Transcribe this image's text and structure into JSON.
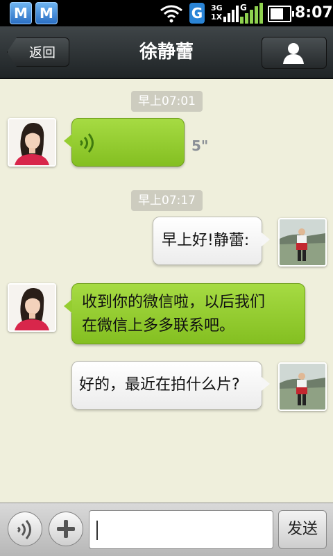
{
  "status_bar": {
    "app_icon_1": "M",
    "app_icon_2": "M",
    "g_badge": "G",
    "network_top": "3G",
    "network_bottom": "1X",
    "time": "8:07"
  },
  "header": {
    "back_label": "返回",
    "title": "徐静蕾",
    "profile_icon": "person-icon"
  },
  "messages": [
    {
      "type": "timestamp",
      "text": "早上07:01"
    },
    {
      "type": "voice",
      "side": "left",
      "duration": "5\""
    },
    {
      "type": "timestamp",
      "text": "早上07:17"
    },
    {
      "type": "text",
      "side": "right",
      "text": "早上好!静蕾:"
    },
    {
      "type": "text",
      "side": "left",
      "line1": "收到你的微信啦，以后我们",
      "line2": "在微信上多多联系吧。"
    },
    {
      "type": "text",
      "side": "right",
      "text": "好的，最近在拍什么片?"
    }
  ],
  "input_bar": {
    "voice_icon": "voice-mode-icon",
    "plus_icon": "plus-icon",
    "input_value": "",
    "send_label": "发送"
  },
  "colors": {
    "chat_background": "#efefdc",
    "incoming_bubble": "#95cd30",
    "outgoing_bubble": "#f6f6f6",
    "header_bar": "#2b3133"
  }
}
